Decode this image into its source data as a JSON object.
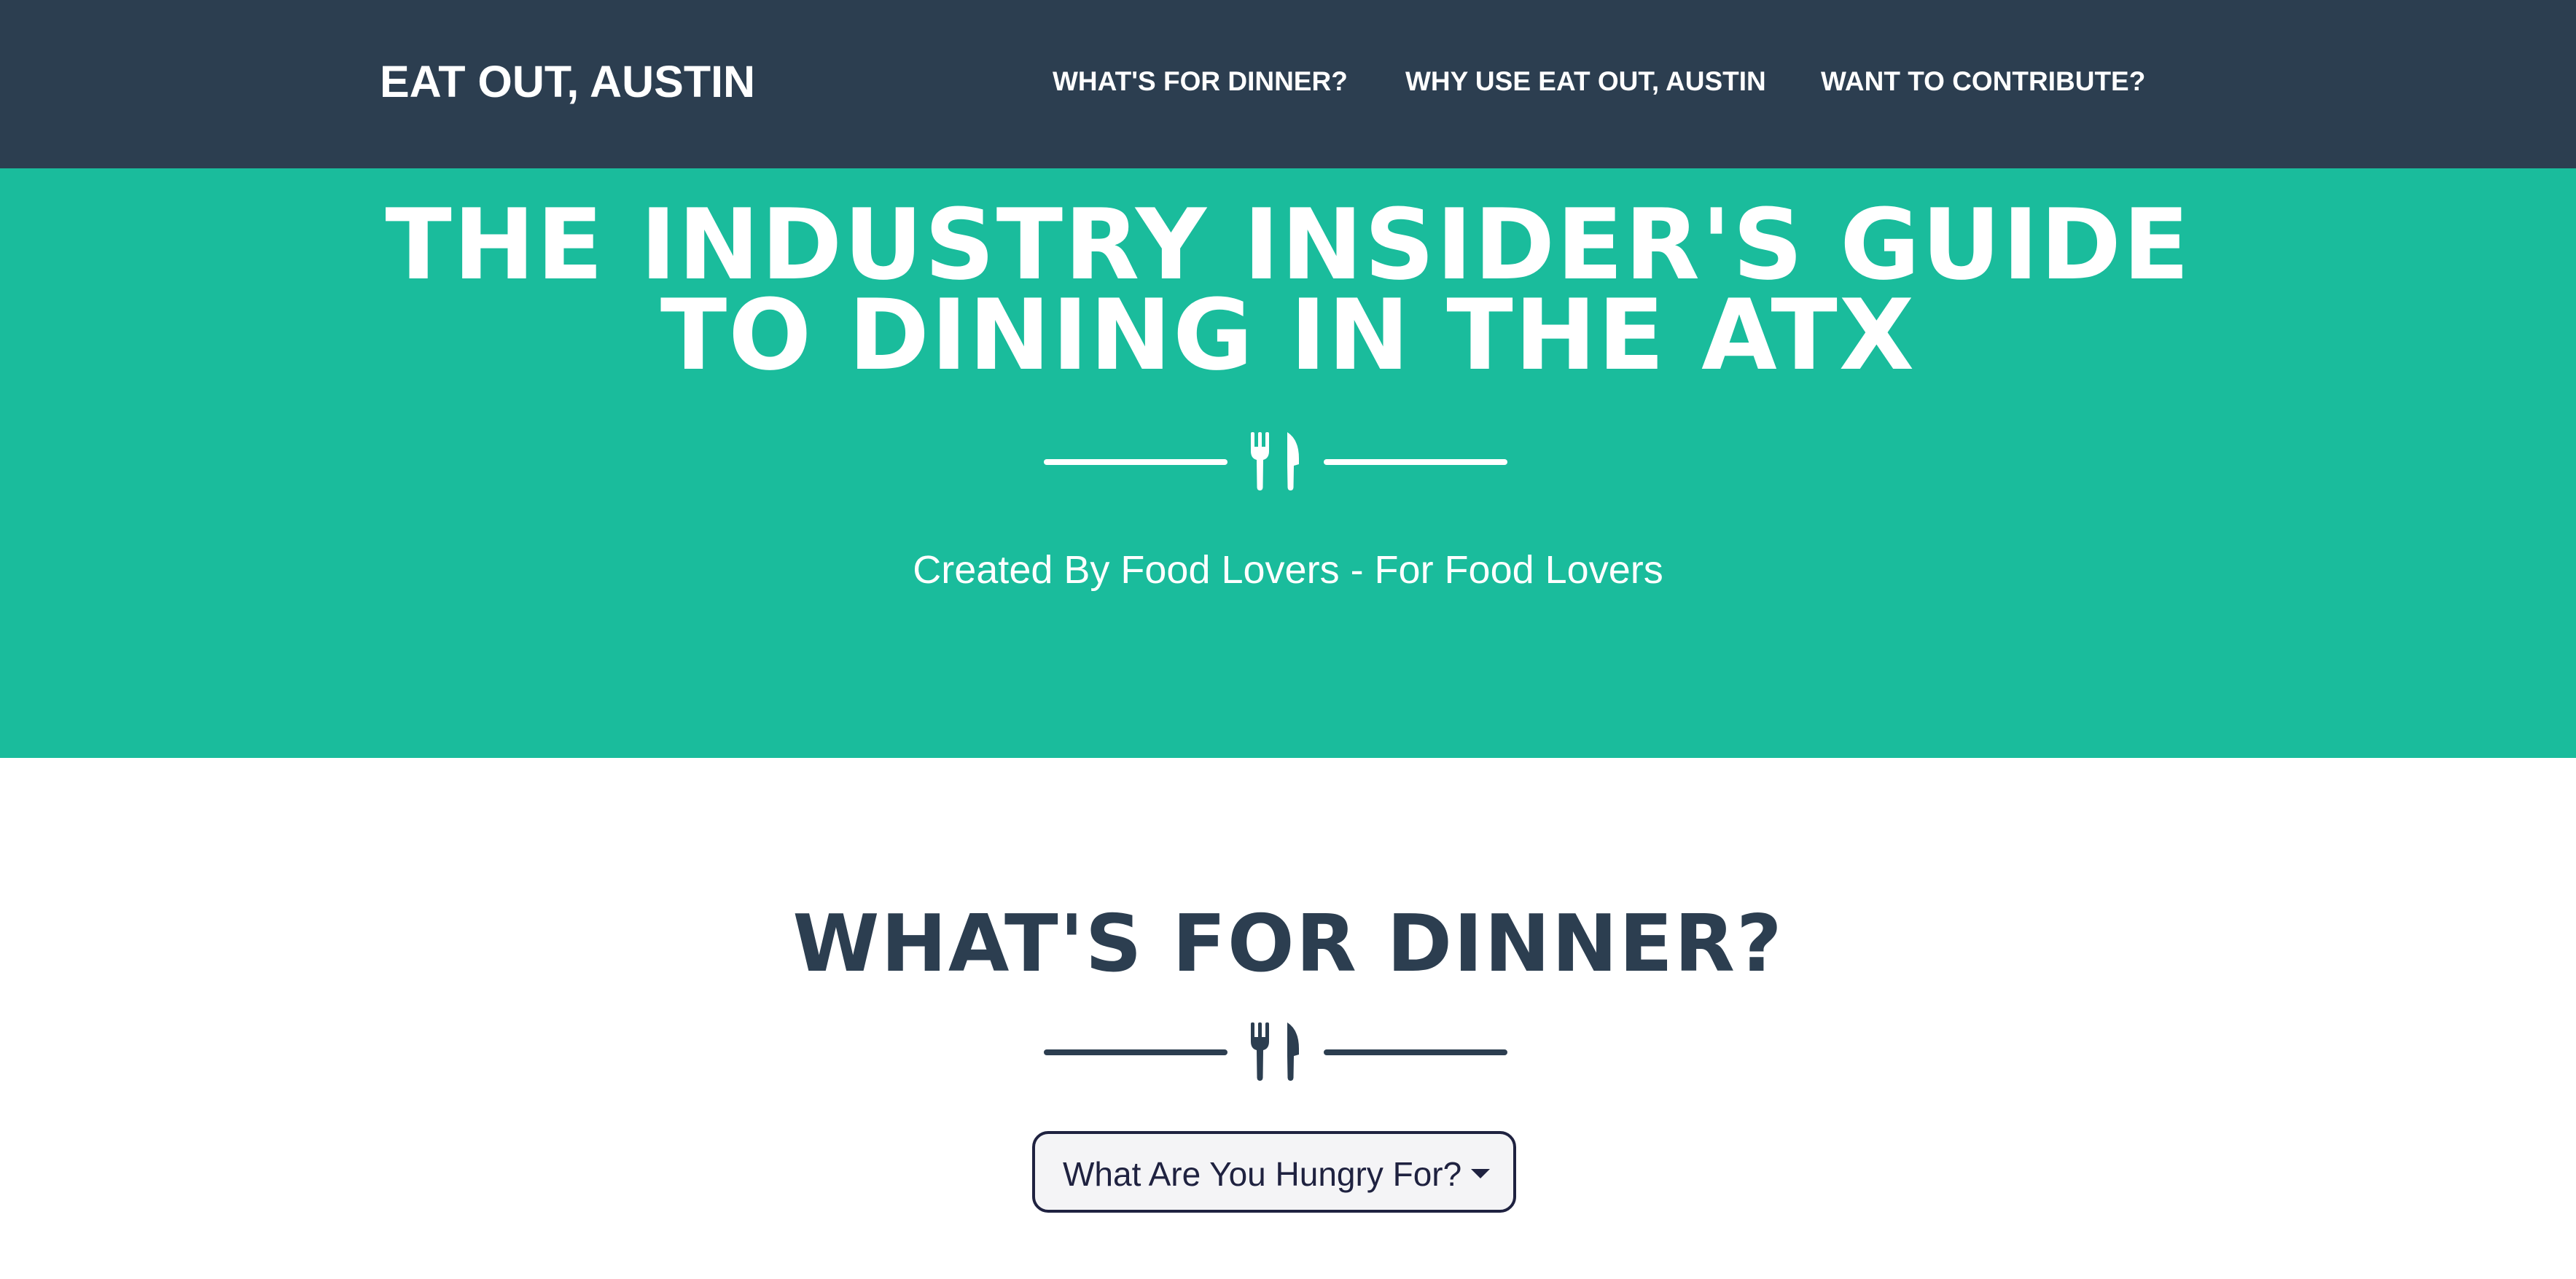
{
  "navbar": {
    "brand": "EAT OUT, AUSTIN",
    "links": [
      {
        "label": "WHAT'S FOR DINNER?"
      },
      {
        "label": "WHY USE EAT OUT, AUSTIN"
      },
      {
        "label": "WANT TO CONTRIBUTE?"
      }
    ]
  },
  "hero": {
    "title_line1": "THE INDUSTRY INSIDER'S GUIDE",
    "title_line2": "TO DINING IN THE ATX",
    "divider_icon": "utensils-icon",
    "subtitle": "Created By Food Lovers - For Food Lovers"
  },
  "dinner_section": {
    "heading": "WHAT'S FOR DINNER?",
    "divider_icon": "utensils-icon",
    "dropdown": {
      "label": "What Are You Hungry For?",
      "caret_icon": "caret-down-icon"
    }
  },
  "colors": {
    "navbar_bg": "#2c3e50",
    "hero_bg": "#1abc9c",
    "heading_text": "#2c3e50",
    "white": "#ffffff",
    "dropdown_border": "#1f2240",
    "dropdown_bg": "#f4f4f6"
  }
}
